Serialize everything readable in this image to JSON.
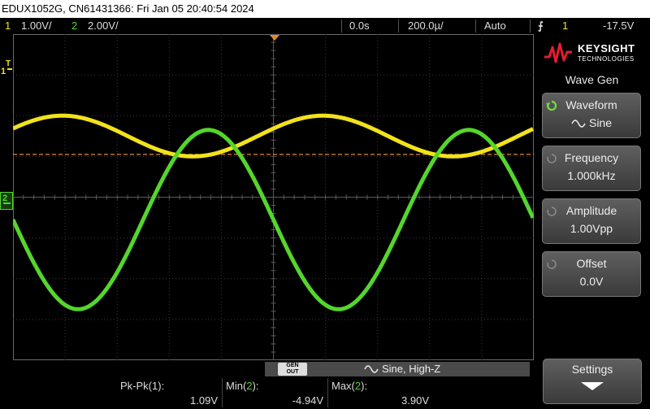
{
  "title_bar": {
    "text": "EDUX1052G, CN61431366: Fri Jan 05 20:40:54 2024"
  },
  "status": {
    "ch1_num": "1",
    "ch1_scale": "1.00V/",
    "ch2_num": "2",
    "ch2_scale": "2.00V/",
    "time_delay": "0.0s",
    "time_base": "200.0µ/",
    "trigger_mode": "Auto",
    "trigger_source": "1",
    "trigger_level": "-17.5V"
  },
  "screen": {
    "ch1_marker": "1",
    "ch1_trigger_marker": "T",
    "ch2_marker": "2",
    "waveforms": [
      {
        "name": "ch1",
        "color": "#f2e21c",
        "amplitude_div": 0.5,
        "offset_div": 1.5,
        "cycles": 2
      },
      {
        "name": "ch2",
        "color": "#54d62c",
        "amplitude_div": 2.2,
        "offset_div": -0.55,
        "cycles": 2
      }
    ],
    "trigger_level_color": "#e08a2c"
  },
  "brand": {
    "name": "KEYSIGHT",
    "sub": "TECHNOLOGIES"
  },
  "menu": {
    "title": "Wave Gen",
    "softkeys": [
      {
        "label": "Waveform",
        "value": "Sine",
        "active": true
      },
      {
        "label": "Frequency",
        "value": "1.000kHz",
        "active": false
      },
      {
        "label": "Amplitude",
        "value": "1.00Vpp",
        "active": false
      },
      {
        "label": "Offset",
        "value": "0.0V",
        "active": false
      }
    ],
    "settings_label": "Settings"
  },
  "generator": {
    "button_line1": "GEN",
    "button_line2": "OUT",
    "status": "Sine, High-Z"
  },
  "measurements": [
    {
      "label_pre": "Pk-Pk(",
      "ch": "1",
      "label_post": "):",
      "value": "1.09V"
    },
    {
      "label_pre": "Min(",
      "ch": "2",
      "label_post": "):",
      "value": "-4.94V"
    },
    {
      "label_pre": "Max(",
      "ch": "2",
      "label_post": "):",
      "value": "3.90V"
    }
  ]
}
